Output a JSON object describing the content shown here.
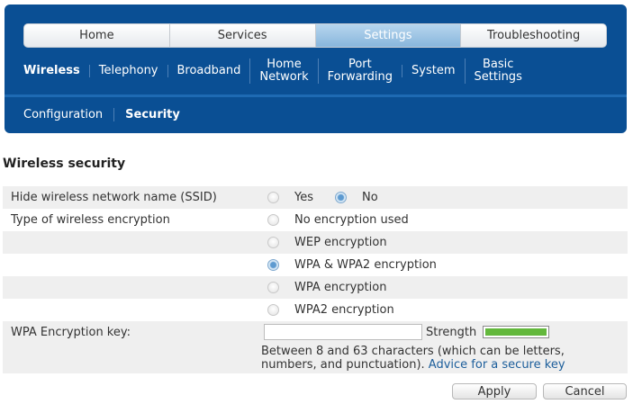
{
  "nav": {
    "tabs": [
      "Home",
      "Services",
      "Settings",
      "Troubleshooting"
    ],
    "active_tab": "Settings",
    "subnav": [
      "Wireless",
      "Telephony",
      "Broadband",
      "Home\nNetwork",
      "Port\nForwarding",
      "System",
      "Basic\nSettings"
    ],
    "active_subnav": "Wireless",
    "tertiary": [
      "Configuration",
      "Security"
    ],
    "active_tertiary": "Security"
  },
  "page": {
    "title": "Wireless security"
  },
  "form": {
    "hide_ssid": {
      "label": "Hide wireless network name (SSID)",
      "options": [
        "Yes",
        "No"
      ],
      "selected": "No"
    },
    "encryption": {
      "label": "Type of wireless encryption",
      "options": [
        "No encryption used",
        "WEP encryption",
        "WPA & WPA2 encryption",
        "WPA encryption",
        "WPA2 encryption"
      ],
      "selected": "WPA & WPA2 encryption"
    },
    "key": {
      "label": "WPA Encryption key:",
      "value": "",
      "strength_label": "Strength",
      "strength_fraction": 1.0,
      "strength_color": "#63b83c",
      "help_text": "Between 8 and 63 characters (which can be letters, numbers, and punctuation).",
      "help_link": "Advice for a secure key"
    }
  },
  "buttons": {
    "apply": "Apply",
    "cancel": "Cancel"
  },
  "colors": {
    "header_bg": "#0a4f94",
    "active_tab": "#9cc6e6",
    "link": "#1c5e9b"
  }
}
